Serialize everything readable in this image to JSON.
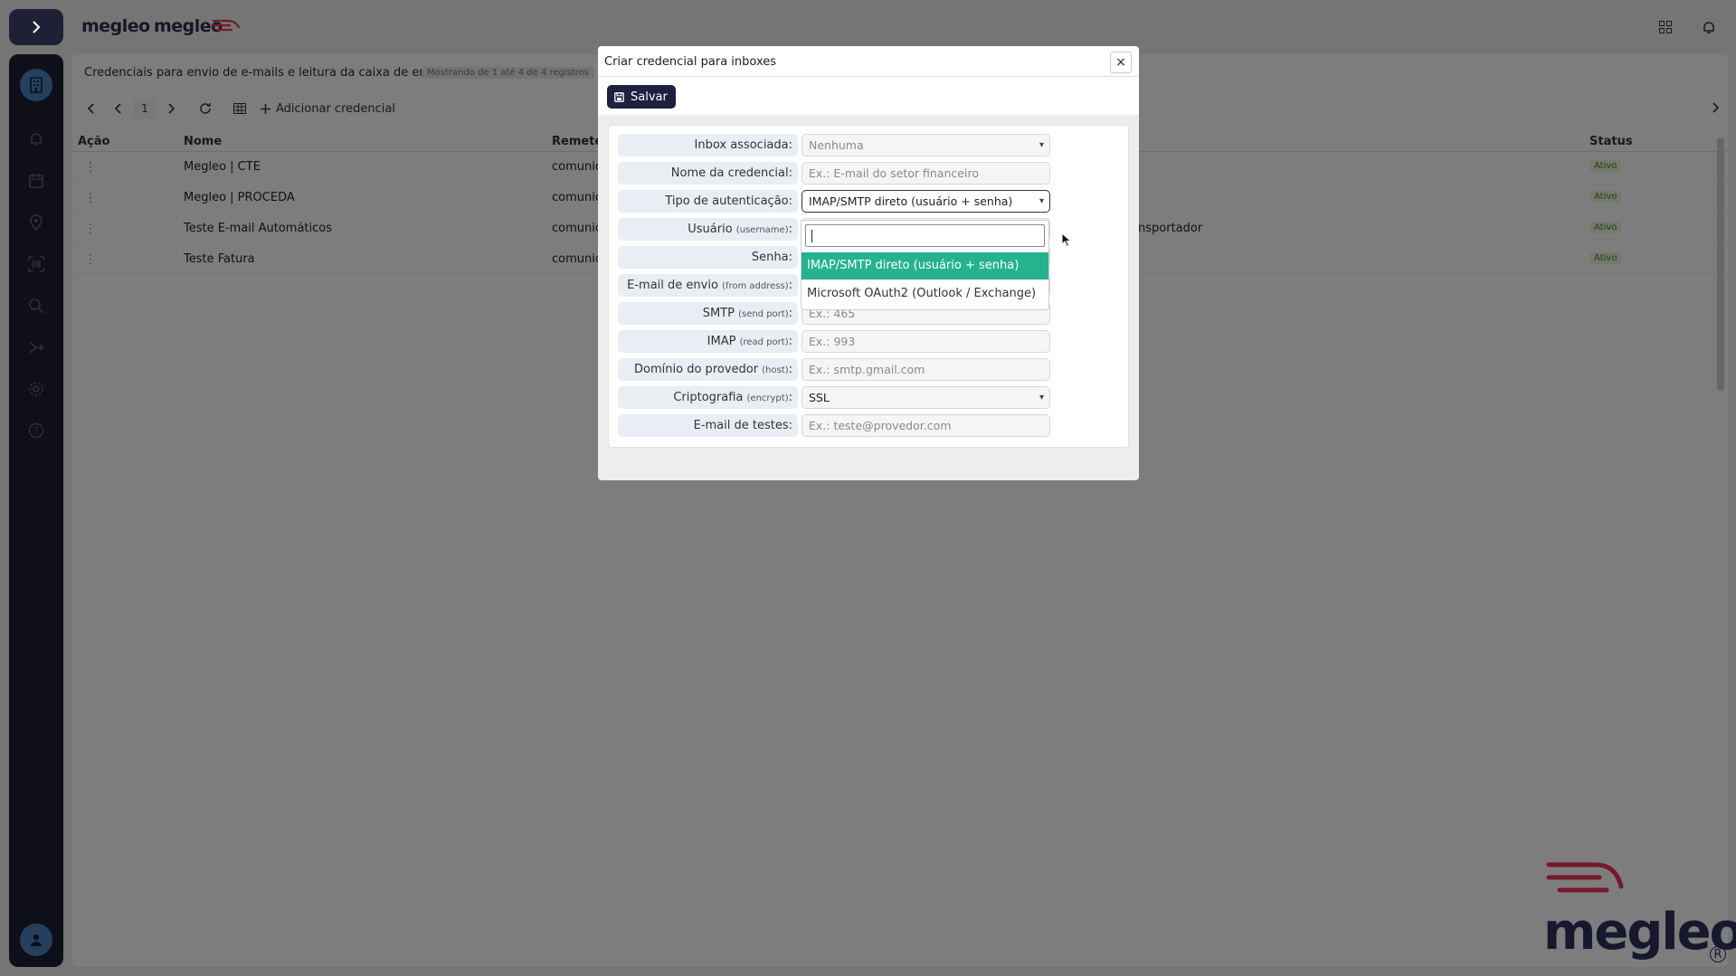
{
  "app": {
    "brand_primary": "megleo",
    "brand_secondary": "megleo",
    "logo_large": "megleo",
    "logo_reg": "R"
  },
  "sidebar": {
    "toggle_icon": "chevron-right-icon",
    "items": [
      {
        "icon": "building-icon",
        "active": true
      },
      {
        "icon": "bell-icon"
      },
      {
        "icon": "calendar-icon"
      },
      {
        "icon": "map-pin-icon"
      },
      {
        "icon": "barcode-scan-icon"
      },
      {
        "icon": "magnifier-icon"
      },
      {
        "icon": "route-icon"
      },
      {
        "icon": "gear-icon"
      },
      {
        "icon": "help-icon"
      }
    ],
    "avatar_icon": "user-icon"
  },
  "topbar": {
    "icons": [
      "apps-grid-icon",
      "bell-icon"
    ]
  },
  "page": {
    "title": "Credenciais para envio de e-mails e leitura da caixa de entrada",
    "subtitle": "Mostrando de 1 até 4 de 4 registros",
    "page_number": "1",
    "add_button_label": "Adicionar credencial"
  },
  "table": {
    "headers": {
      "action": "Ação",
      "name": "Nome",
      "sender": "Remete",
      "status": "Status"
    },
    "rows": [
      {
        "name": "Megleo | CTE",
        "sender": "comunic",
        "extra": "",
        "status": "Ativo"
      },
      {
        "name": "Megleo | PROCEDA",
        "sender": "comunic",
        "extra": "",
        "status": "Ativo"
      },
      {
        "name": "Teste E-mail Automáticos",
        "sender": "comunic",
        "extra": "nsportador",
        "status": "Ativo"
      },
      {
        "name": "Teste Fatura",
        "sender": "comunic",
        "extra": "",
        "status": "Ativo"
      }
    ]
  },
  "modal": {
    "title": "Criar credencial para inboxes",
    "close_label": "×",
    "save_label": "Salvar",
    "fields": [
      {
        "label": "Inbox associada:",
        "hint": "",
        "value": "Nenhuma",
        "type": "select"
      },
      {
        "label": "Nome da credencial:",
        "hint": "",
        "value": "Ex.: E-mail do setor financeiro",
        "type": "input"
      },
      {
        "label": "Tipo de autenticação:",
        "hint": "",
        "value": "IMAP/SMTP direto (usuário + senha)",
        "type": "select-open"
      },
      {
        "label": "Usuário",
        "hint": "(username)",
        "value": "",
        "type": "input"
      },
      {
        "label": "Senha:",
        "hint": "",
        "value": "",
        "type": "input"
      },
      {
        "label": "E-mail de envio",
        "hint": "(from address)",
        "value": "",
        "type": "input"
      },
      {
        "label": "SMTP",
        "hint": "(send port)",
        "value": "Ex.: 465",
        "type": "input"
      },
      {
        "label": "IMAP",
        "hint": "(read port)",
        "value": "Ex.: 993",
        "type": "input"
      },
      {
        "label": "Domínio do provedor",
        "hint": "(host)",
        "value": "Ex.: smtp.gmail.com",
        "type": "input"
      },
      {
        "label": "Criptografia",
        "hint": "(encrypt)",
        "value": "SSL",
        "type": "select"
      },
      {
        "label": "E-mail de testes:",
        "hint": "",
        "value": "Ex.: teste@provedor.com",
        "type": "input"
      }
    ],
    "dropdown": {
      "search_value": "",
      "options": [
        {
          "label": "IMAP/SMTP direto (usuário + senha)",
          "selected": true
        },
        {
          "label": "Microsoft OAuth2 (Outlook / Exchange)",
          "selected": false
        }
      ]
    }
  },
  "colors": {
    "sidebar": "#1f1f35",
    "accent": "#4a7fbd",
    "selected_option": "#24b38e",
    "save_button": "#1f1f3f",
    "brand_pink": "#e8325a"
  }
}
